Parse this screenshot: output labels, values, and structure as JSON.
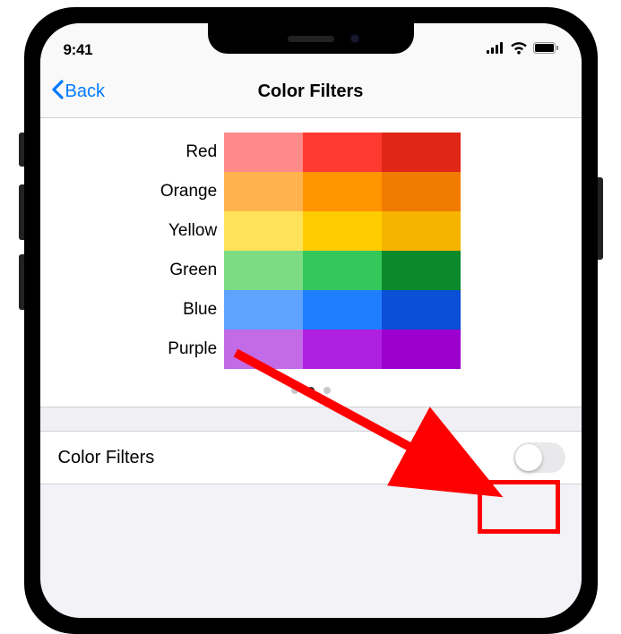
{
  "status_bar": {
    "time": "9:41"
  },
  "nav": {
    "back_label": "Back",
    "title": "Color Filters"
  },
  "color_preview": {
    "rows": [
      {
        "label": "Red",
        "colors": [
          "#ff8a8a",
          "#ff3a30",
          "#e02617"
        ]
      },
      {
        "label": "Orange",
        "colors": [
          "#ffb24d",
          "#ff9500",
          "#f07b00"
        ]
      },
      {
        "label": "Yellow",
        "colors": [
          "#ffe259",
          "#ffcc00",
          "#f5b400"
        ]
      },
      {
        "label": "Green",
        "colors": [
          "#7ddb84",
          "#34c759",
          "#0a8a2a"
        ]
      },
      {
        "label": "Blue",
        "colors": [
          "#5ea3ff",
          "#1e7eff",
          "#0a4fd6"
        ]
      },
      {
        "label": "Purple",
        "colors": [
          "#c36ae6",
          "#b020e0",
          "#9b00cf"
        ]
      }
    ],
    "pages": 3,
    "current_page": 1
  },
  "settings": {
    "color_filters_label": "Color Filters",
    "color_filters_on": false
  }
}
